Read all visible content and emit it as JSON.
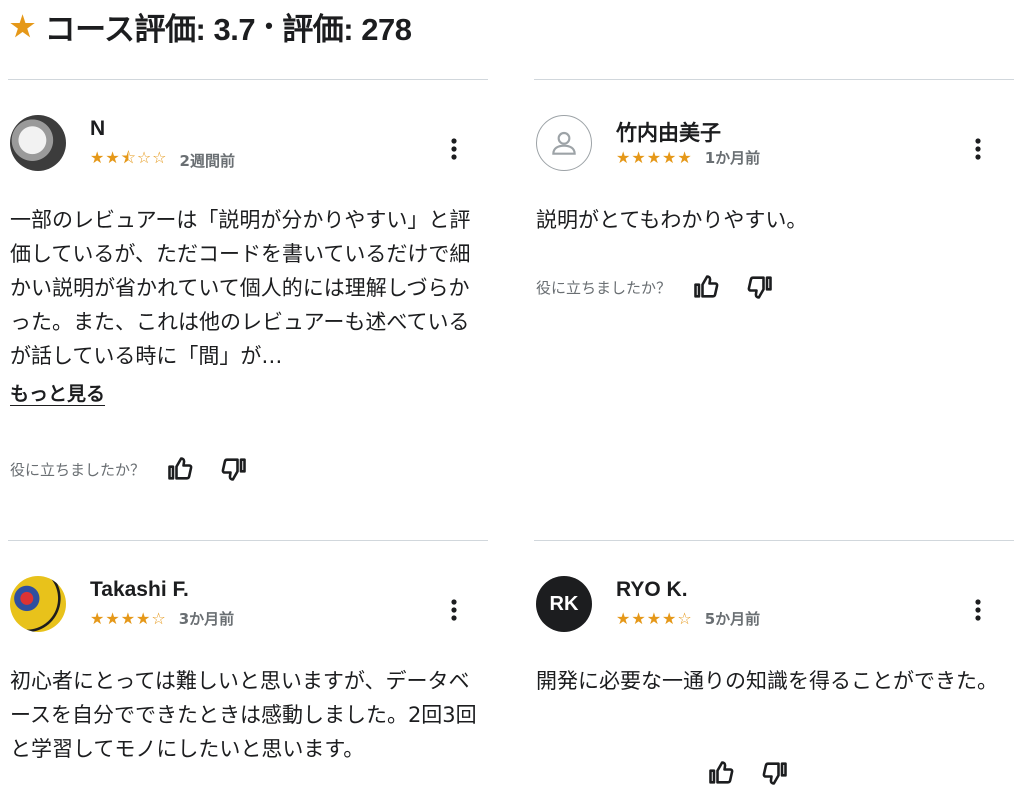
{
  "header": {
    "star_icon": "star-icon",
    "rating_label": "コース評価: 3.7",
    "separator": "•",
    "count_label": "評価: 278"
  },
  "colors": {
    "star": "#e59819",
    "text": "#1c1d1f",
    "muted": "#6a6f73",
    "divider": "#d1d7dc"
  },
  "reviews": [
    {
      "name": "N",
      "stars": "★★⯪☆☆",
      "rating": 2.5,
      "time": "2週間前",
      "body": "一部のレビュアーは「説明が分かりやすい」と評価しているが、ただコードを書いているだけで細かい説明が省かれていて個人的には理解しづらかった。また、これは他のレビュアーも述べているが話している時に「間」が…",
      "more": "もっと見る",
      "helpful": "役に立ちましたか？"
    },
    {
      "name": "竹内由美子",
      "stars": "★★★★★",
      "rating": 5,
      "time": "1か月前",
      "body": "説明がとてもわかりやすい。",
      "helpful": "役に立ちましたか？"
    },
    {
      "name": "Takashi F.",
      "stars": "★★★★☆",
      "rating": 4,
      "time": "3か月前",
      "body": "初心者にとっては難しいと思いますが、データベースを自分でできたときは感動しました。2回3回と学習してモノにしたいと思います。"
    },
    {
      "name": "RYO K.",
      "initials": "RK",
      "stars": "★★★★☆",
      "rating": 4,
      "time": "5か月前",
      "body": "開発に必要な一通りの知識を得ることができた。"
    }
  ]
}
